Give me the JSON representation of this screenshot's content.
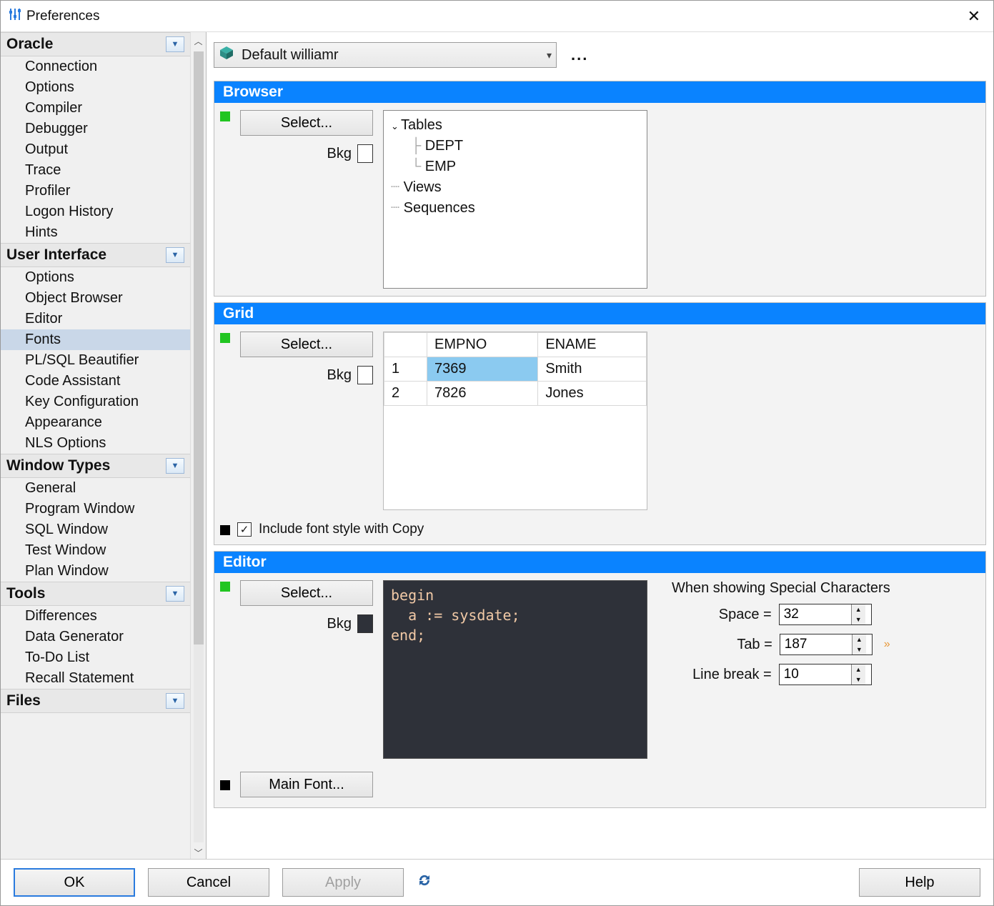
{
  "window": {
    "title": "Preferences"
  },
  "sidebar": {
    "categories": [
      {
        "name": "Oracle",
        "selected": null,
        "items": [
          "Connection",
          "Options",
          "Compiler",
          "Debugger",
          "Output",
          "Trace",
          "Profiler",
          "Logon History",
          "Hints"
        ]
      },
      {
        "name": "User Interface",
        "selected": "Fonts",
        "items": [
          "Options",
          "Object Browser",
          "Editor",
          "Fonts",
          "PL/SQL Beautifier",
          "Code Assistant",
          "Key Configuration",
          "Appearance",
          "NLS Options"
        ]
      },
      {
        "name": "Window Types",
        "selected": null,
        "items": [
          "General",
          "Program Window",
          "SQL Window",
          "Test Window",
          "Plan Window"
        ]
      },
      {
        "name": "Tools",
        "selected": null,
        "items": [
          "Differences",
          "Data Generator",
          "To-Do List",
          "Recall Statement"
        ]
      },
      {
        "name": "Files",
        "selected": null,
        "items": []
      }
    ]
  },
  "preferenceSet": {
    "label": "Default williamr",
    "ellipsis": "..."
  },
  "browser": {
    "title": "Browser",
    "select_label": "Select...",
    "bkg_label": "Bkg",
    "tree": {
      "tables_label": "Tables",
      "items": [
        "DEPT",
        "EMP"
      ],
      "views_label": "Views",
      "sequences_label": "Sequences"
    }
  },
  "grid": {
    "title": "Grid",
    "select_label": "Select...",
    "bkg_label": "Bkg",
    "columns": [
      "",
      "EMPNO",
      "ENAME"
    ],
    "rows": [
      {
        "n": "1",
        "empno": "7369",
        "ename": "Smith"
      },
      {
        "n": "2",
        "empno": "7826",
        "ename": "Jones"
      }
    ],
    "include_label": "Include font style with Copy",
    "include_checked": true
  },
  "editor": {
    "title": "Editor",
    "select_label": "Select...",
    "bkg_label": "Bkg",
    "code": "begin\n  a := sysdate;\nend;",
    "special_header": "When showing Special Characters",
    "space_label": "Space =",
    "tab_label": "Tab =",
    "break_label": "Line break =",
    "space_value": "32",
    "tab_value": "187",
    "break_value": "10",
    "mainfont_label": "Main Font..."
  },
  "footer": {
    "ok": "OK",
    "cancel": "Cancel",
    "apply": "Apply",
    "help": "Help"
  }
}
